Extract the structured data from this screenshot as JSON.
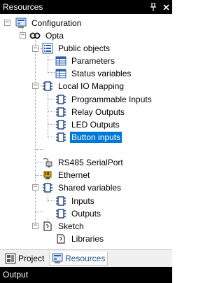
{
  "panel": {
    "title": "Resources",
    "pin_glyph": "↔",
    "close_glyph": "✕"
  },
  "tree": {
    "configuration": {
      "label": "Configuration",
      "icon": "configuration-icon"
    },
    "opta": {
      "label": "Opta",
      "icon": "opta-device-icon"
    },
    "public_objects": {
      "label": "Public objects",
      "icon": "public-objects-icon"
    },
    "parameters": {
      "label": "Parameters",
      "icon": "table-icon"
    },
    "status_variables": {
      "label": "Status variables",
      "icon": "table-icon"
    },
    "local_io": {
      "label": "Local IO Mapping",
      "icon": "io-mapping-icon"
    },
    "programmable_inputs": {
      "label": "Programmable Inputs",
      "icon": "io-mapping-icon"
    },
    "relay_outputs": {
      "label": "Relay Outputs",
      "icon": "io-mapping-icon"
    },
    "led_outputs": {
      "label": "LED Outputs",
      "icon": "io-mapping-icon"
    },
    "button_inputs": {
      "label": "Button inputs",
      "icon": "io-mapping-icon",
      "selected": true
    },
    "rs485": {
      "label": "RS485 SerialPort",
      "icon": "serial-port-icon"
    },
    "ethernet": {
      "label": "Ethernet",
      "icon": "ethernet-icon"
    },
    "shared_variables": {
      "label": "Shared variables",
      "icon": "shared-variables-icon"
    },
    "inputs": {
      "label": "Inputs",
      "icon": "io-mapping-icon"
    },
    "outputs": {
      "label": "Outputs",
      "icon": "io-mapping-icon"
    },
    "sketch": {
      "label": "Sketch",
      "icon": "sketch-icon"
    },
    "libraries": {
      "label": "Libraries",
      "icon": "sketch-icon"
    }
  },
  "tabs": [
    {
      "label": "Project",
      "icon": "project-icon",
      "active": false
    },
    {
      "label": "Resources",
      "icon": "resources-icon",
      "active": true
    }
  ],
  "output_panel": {
    "title": "Output"
  },
  "colors": {
    "selection": "#0078d7",
    "header_bg": "#000000",
    "icon_blue": "#1f5fbf"
  }
}
